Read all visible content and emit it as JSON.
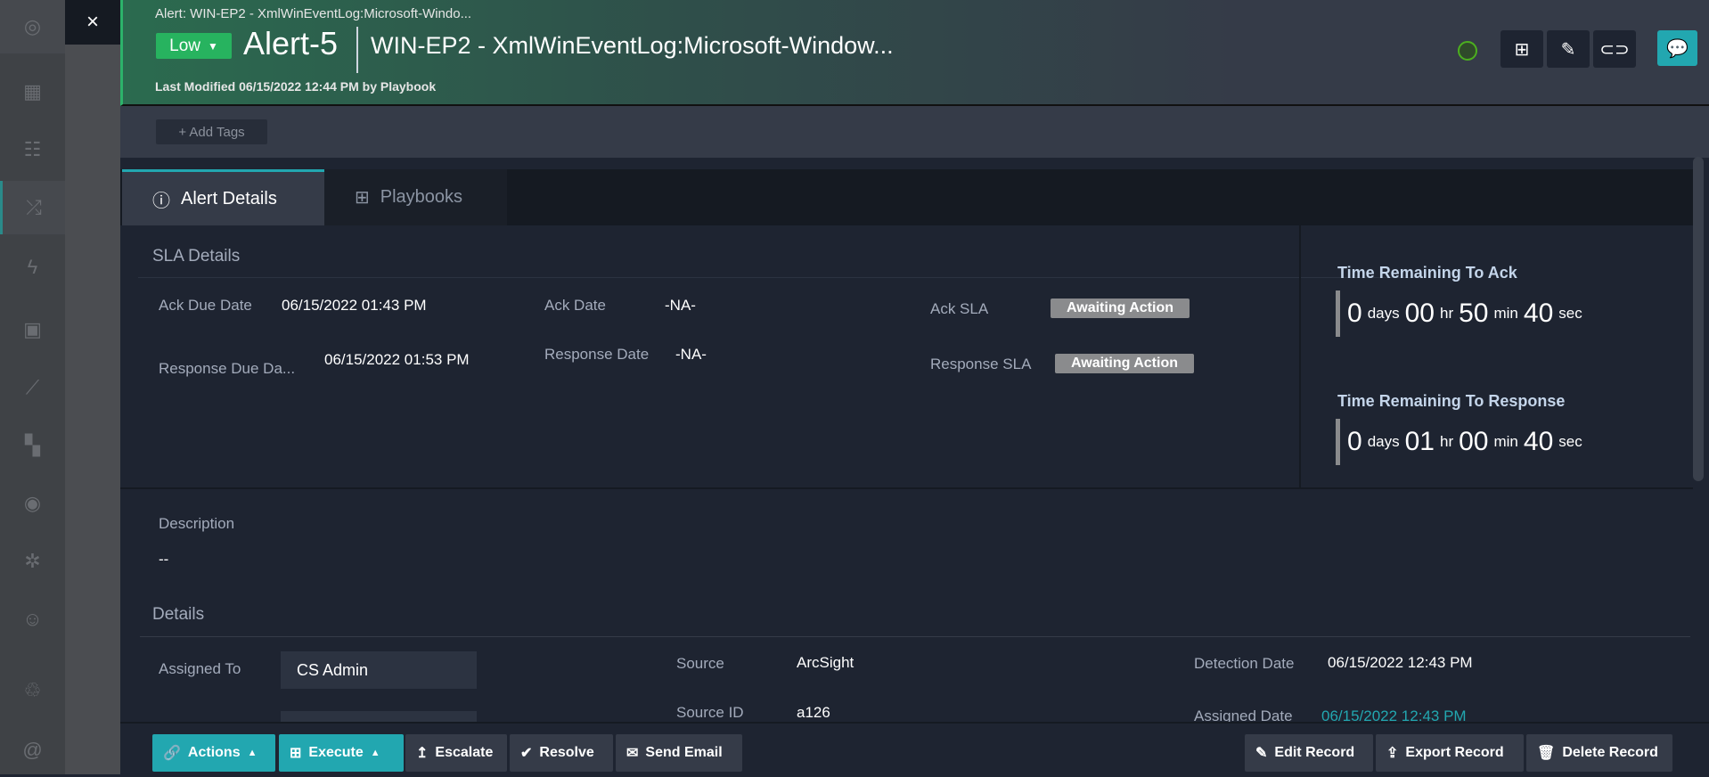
{
  "close_icon": "×",
  "header": {
    "breadcrumb": "Alert: WIN-EP2 - XmlWinEventLog:Microsoft-Windo...",
    "severity": "Low",
    "alert_id": "Alert-5",
    "title": "WIN-EP2 - XmlWinEventLog:Microsoft-Window...",
    "last_modified": "Last Modified 06/15/2022 12:44 PM by Playbook"
  },
  "tags": {
    "add_label": "+ Add Tags"
  },
  "tabs": [
    {
      "label": "Alert Details"
    },
    {
      "label": "Playbooks"
    }
  ],
  "sla": {
    "heading": "SLA Details",
    "ack_due_label": "Ack Due Date",
    "ack_due": "06/15/2022 01:43 PM",
    "resp_due_label": "Response Due Da...",
    "resp_due": "06/15/2022 01:53 PM",
    "ack_date_label": "Ack Date",
    "ack_date": "-NA-",
    "resp_date_label": "Response Date",
    "resp_date": "-NA-",
    "ack_sla_label": "Ack SLA",
    "ack_sla": "Awaiting Action",
    "resp_sla_label": "Response SLA",
    "resp_sla": "Awaiting Action"
  },
  "timers": [
    {
      "heading": "Time Remaining To Ack",
      "days": "0",
      "hr": "00",
      "min": "50",
      "sec": "40"
    },
    {
      "heading": "Time Remaining To Response",
      "days": "0",
      "hr": "01",
      "min": "00",
      "sec": "40"
    }
  ],
  "units": {
    "days": "days",
    "hr": "hr",
    "min": "min",
    "sec": "sec"
  },
  "description": {
    "label": "Description",
    "value": "--"
  },
  "details": {
    "heading": "Details",
    "assigned_to_label": "Assigned To",
    "assigned_to": "CS Admin",
    "source_label": "Source",
    "source": "ArcSight",
    "source_id_label": "Source ID",
    "source_id": "a126",
    "detection_label": "Detection Date",
    "detection": "06/15/2022 12:43 PM",
    "assigned_date_label": "Assigned Date",
    "assigned_date": "06/15/2022 12:43 PM"
  },
  "actions": {
    "actions": "Actions",
    "execute": "Execute",
    "escalate": "Escalate",
    "resolve": "Resolve",
    "send_email": "Send Email",
    "edit": "Edit Record",
    "export": "Export Record",
    "delete": "Delete Record"
  },
  "colors": {
    "accent": "#22a7b0",
    "low": "#27b35f",
    "badge": "#8a8b8d"
  }
}
